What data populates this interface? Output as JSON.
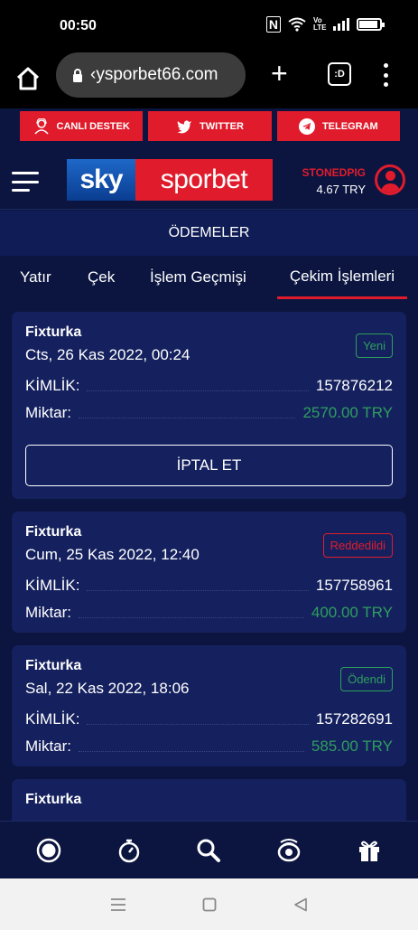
{
  "status_bar": {
    "time": "00:50",
    "network_label": "Vo LTE",
    "battery_level": 0.85
  },
  "browser": {
    "url": "‹ysporbet66.com",
    "tabs_label": ":D"
  },
  "social": [
    {
      "label": "CANLI DESTEK",
      "icon": "support-agent-icon"
    },
    {
      "label": "TWITTER",
      "icon": "twitter-icon"
    },
    {
      "label": "TELEGRAM",
      "icon": "telegram-icon"
    }
  ],
  "header": {
    "logo_left": "sky",
    "logo_right": "sporbet",
    "username": "STONEDPIG",
    "balance": "4.67 TRY"
  },
  "section_title": "ÖDEMELER",
  "tabs": [
    {
      "label": "Yatır",
      "active": false
    },
    {
      "label": "Çek",
      "active": false
    },
    {
      "label": "İşlem Geçmişi",
      "active": false
    },
    {
      "label": "Çekim İşlemleri",
      "active": true
    }
  ],
  "labels": {
    "id": "KİMLİK:",
    "amount": "Miktar:",
    "cancel": "İPTAL ET"
  },
  "transactions": [
    {
      "provider": "Fixturka",
      "date": "Cts, 26 Kas 2022, 00:24",
      "status": "Yeni",
      "status_color": "#2e9e5e",
      "id": "157876212",
      "amount": "2570.00 TRY"
    },
    {
      "provider": "Fixturka",
      "date": "Cum, 25 Kas 2022, 12:40",
      "status": "Reddedildi",
      "status_color": "#e01c2c",
      "id": "157758961",
      "amount": "400.00 TRY"
    },
    {
      "provider": "Fixturka",
      "date": "Sal, 22 Kas 2022, 18:06",
      "status": "Ödendi",
      "status_color": "#2e9e5e",
      "id": "157282691",
      "amount": "585.00 TRY"
    },
    {
      "provider": "Fixturka"
    }
  ],
  "bottom_nav": [
    "live-icon",
    "stopwatch-icon",
    "search-icon",
    "casino-chip-icon",
    "gift-icon"
  ],
  "colors": {
    "background": "#0b1540",
    "card": "#15215e",
    "accent_red": "#e01c2c",
    "status_green": "#2e9e5e"
  }
}
